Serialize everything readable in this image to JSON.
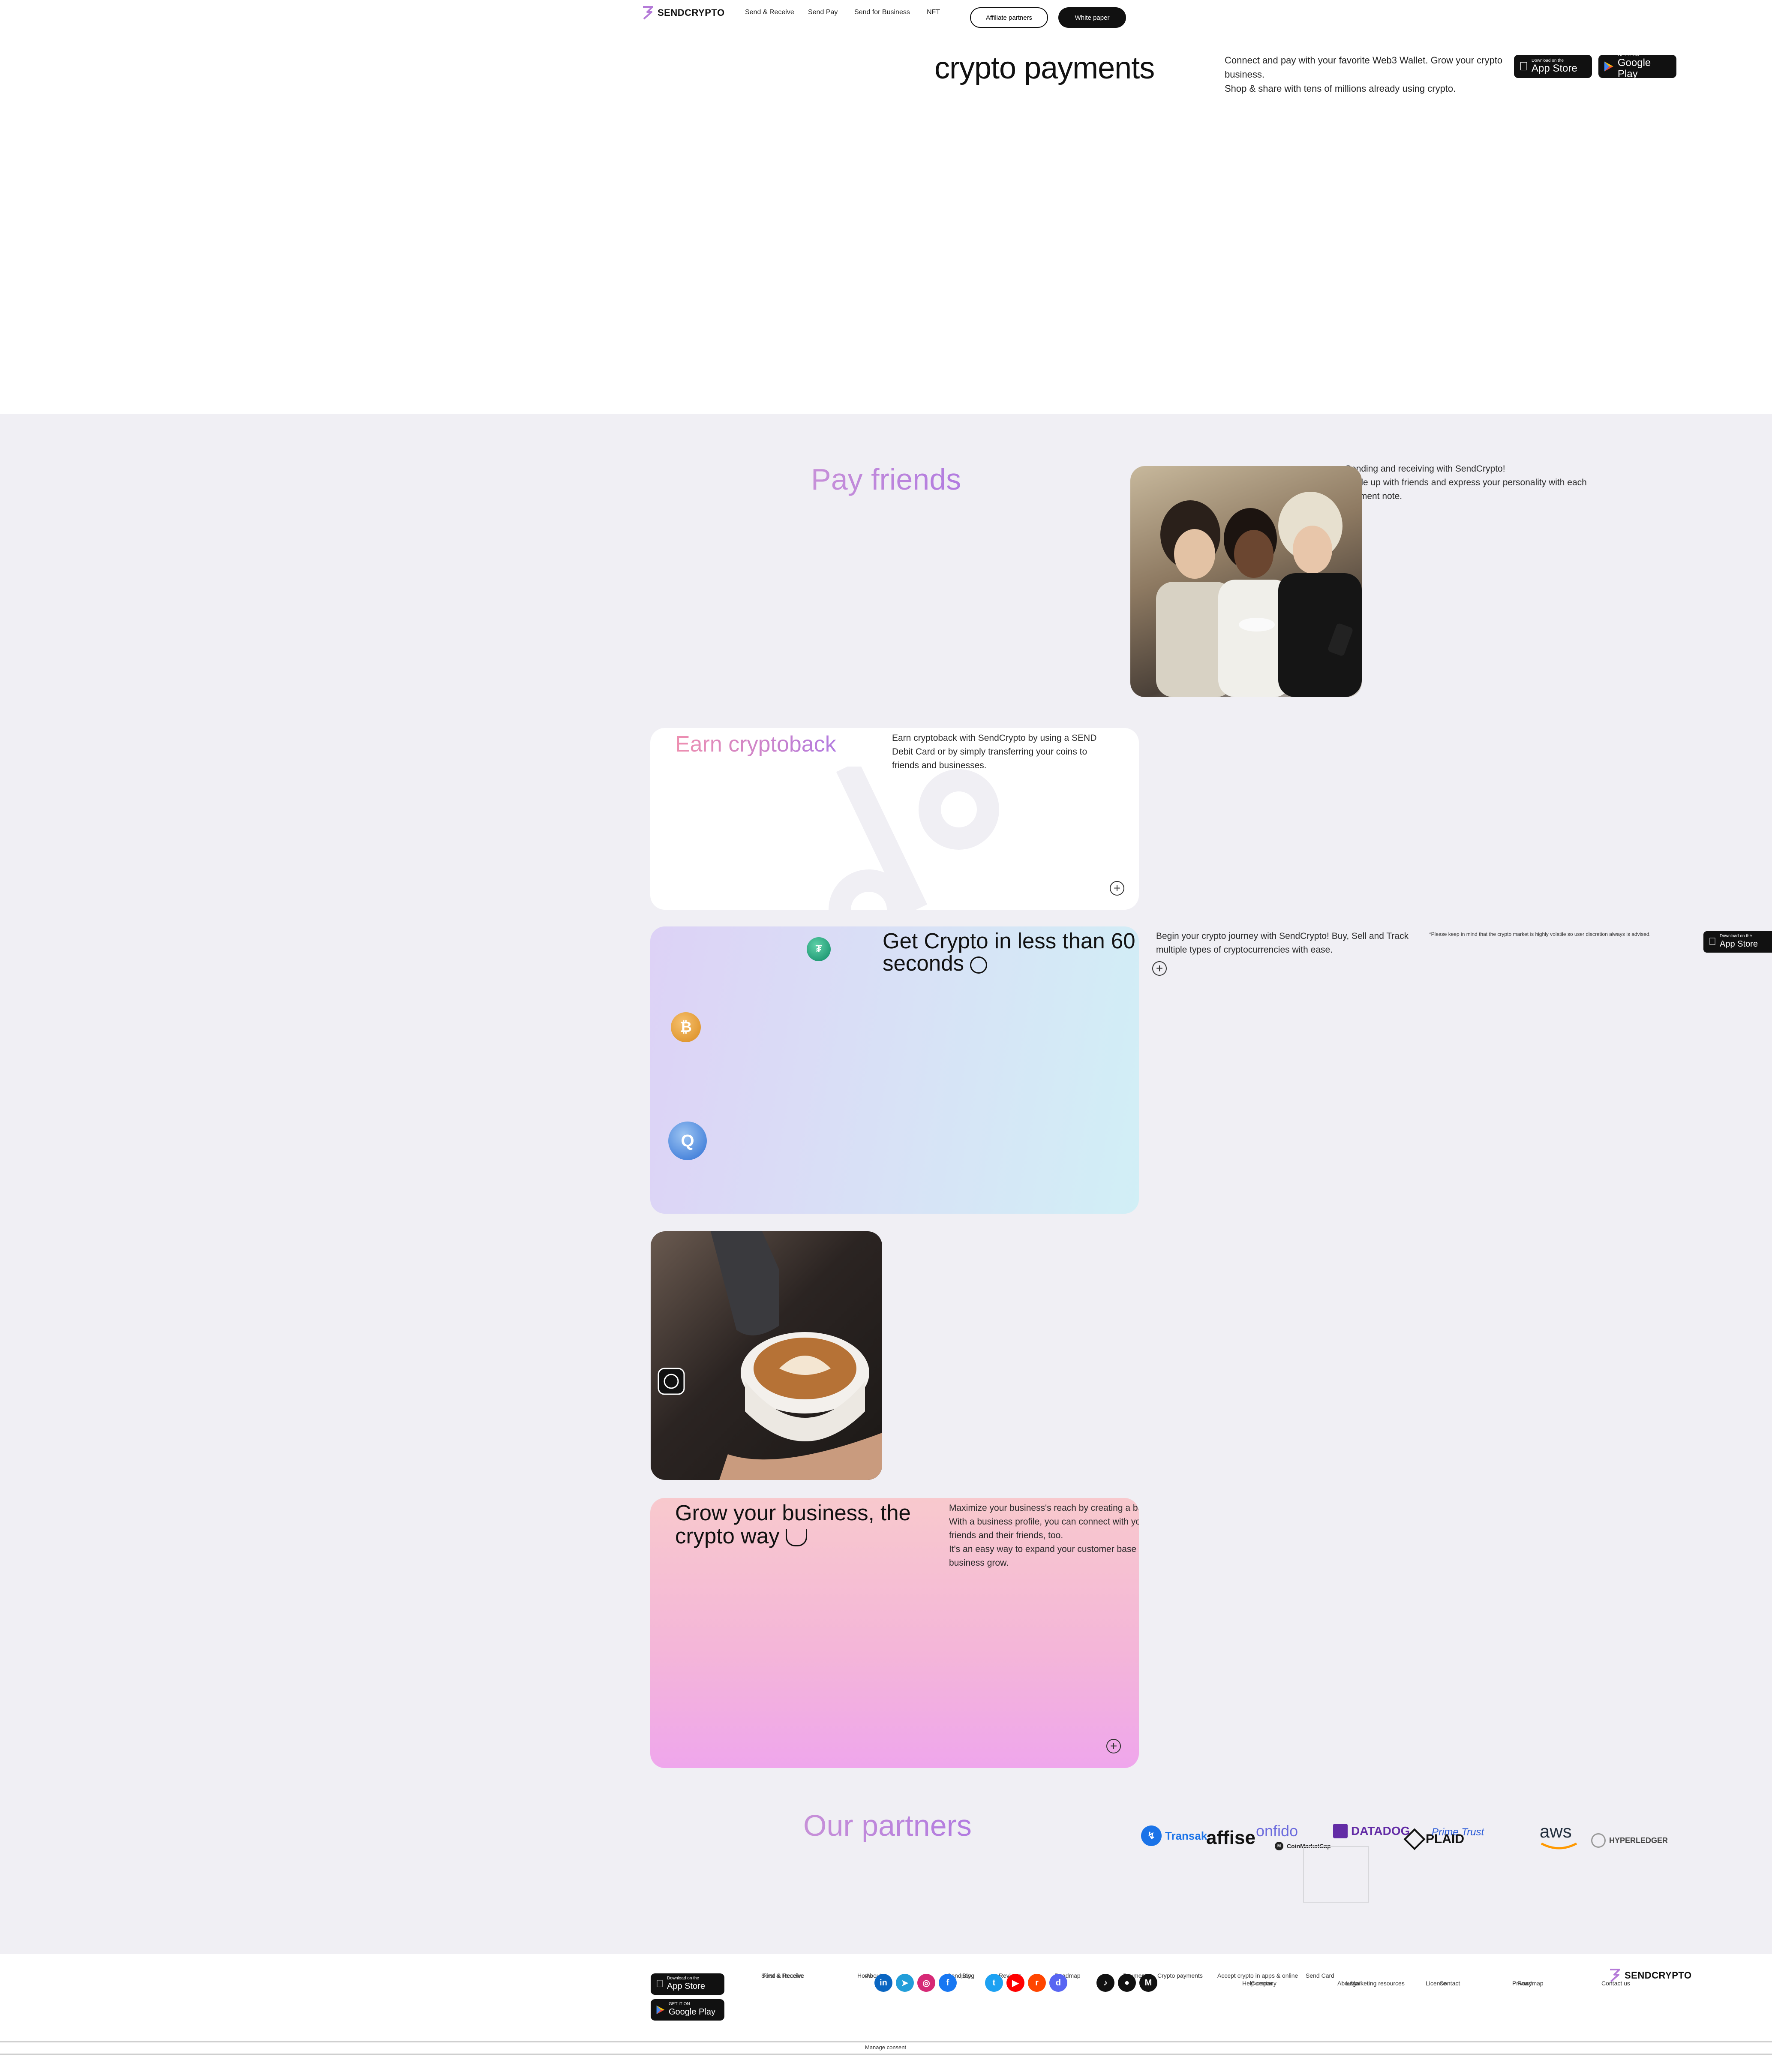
{
  "header": {
    "logo_text": "SENDCRYPTO",
    "nav": [
      "Send & Receive",
      "Send Pay",
      "Send for Business",
      "NFT"
    ],
    "affiliate_label": "Affiliate partners",
    "whitepaper_label": "White paper"
  },
  "hero": {
    "title": "crypto payments",
    "text_line1": "Connect and pay with your favorite Web3 Wallet. Grow your crypto business.",
    "text_line2": "Shop & share with tens of millions already using crypto."
  },
  "badges": {
    "appstore_small": "Download on the",
    "appstore_big": "App Store",
    "google_small": "GET IT ON",
    "google_big": "Google Play"
  },
  "pay_friends": {
    "title": "Pay friends",
    "line1": "Sending and receiving with SendCrypto!",
    "line2": "Settle up with friends and express your personality with each",
    "line3": "payment note."
  },
  "cryptoback": {
    "title": "Earn cryptoback",
    "text": "Earn cryptoback with SendCrypto by using a SEND Debit Card or by simply transferring your coins to friends and businesses."
  },
  "get_crypto": {
    "title": "Get Crypto in less than 60 seconds",
    "text": "Begin your crypto journey with SendCrypto! Buy, Sell and Track multiple types of cryptocurrencies with ease.",
    "disclaimer": "*Please keep in mind that the crypto market is highly volatile so user discretion always is advised."
  },
  "business": {
    "title": "Grow your business, the crypto way",
    "line1": "Maximize your business's reach by creating a business profile!",
    "line2": "With a business profile, you can connect with your customers' friends and their friends, too.",
    "line3": "It's an easy way to expand your customer base and help your business grow."
  },
  "partners": {
    "title": "Our partners",
    "items": [
      "Transak",
      "affise",
      "onfido",
      "CoinMarketCap",
      "DATADOG",
      "PLAID",
      "Prime Trust",
      "aws",
      "HYPERLEDGER"
    ]
  },
  "footer": {
    "links": [
      "Send & Receive",
      "First & Receive",
      "Home",
      "About",
      "Sendpay",
      "Blog",
      "Reviews",
      "Send",
      "Merchant",
      "Roadmap",
      "Tokenomics",
      "Store",
      "Payments",
      "Crypto payments",
      "Payment links",
      "Accept crypto in apps & online",
      "Send Card",
      "Help center",
      "Company",
      "About",
      "Marketing resources",
      "Legal",
      "License",
      "Contact",
      "Privacy",
      "Roadmap",
      "Contact us"
    ],
    "logo_text": "SENDCRYPTO",
    "manage_consent": "Manage consent"
  },
  "colors": {
    "accent_purple": "#b27be0",
    "pink_gradient_end": "#f0a8ea",
    "grey_bg": "#f0eff4"
  }
}
